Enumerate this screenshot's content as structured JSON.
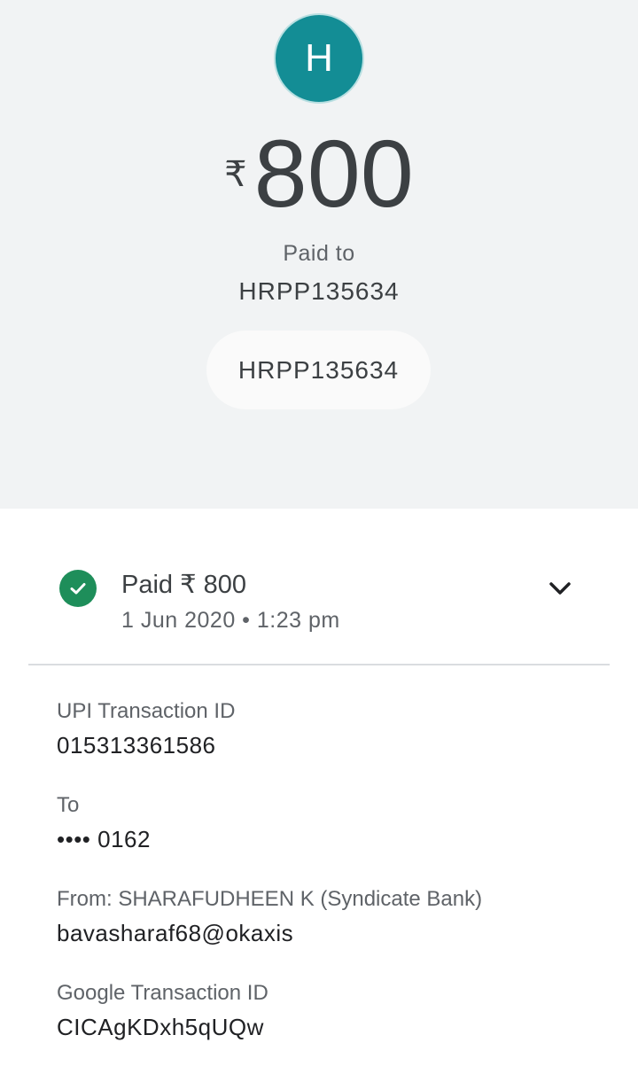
{
  "header": {
    "avatar_letter": "H",
    "currency_symbol": "₹",
    "amount": "800",
    "paid_to_label": "Paid to",
    "payee_name": "HRPP135634",
    "payee_chip": "HRPP135634"
  },
  "status": {
    "title": "Paid ₹ 800",
    "date": "1 Jun 2020 • 1:23 pm",
    "icon": "check-circle-icon",
    "expand_icon": "chevron-down-icon"
  },
  "details": [
    {
      "label": "UPI Transaction ID",
      "value": "015313361586"
    },
    {
      "label": "To",
      "value": "•••• 0162"
    },
    {
      "label": "From: SHARAFUDHEEN K (Syndicate Bank)",
      "value": "bavasharaf68@okaxis"
    },
    {
      "label": "Google Transaction ID",
      "value": "CICAgKDxh5qUQw"
    }
  ],
  "colors": {
    "header_bg": "#f1f3f4",
    "avatar_bg": "#138d95",
    "success_green": "#1e8e5a",
    "text_primary": "#3c4043",
    "text_secondary": "#5f6368"
  }
}
